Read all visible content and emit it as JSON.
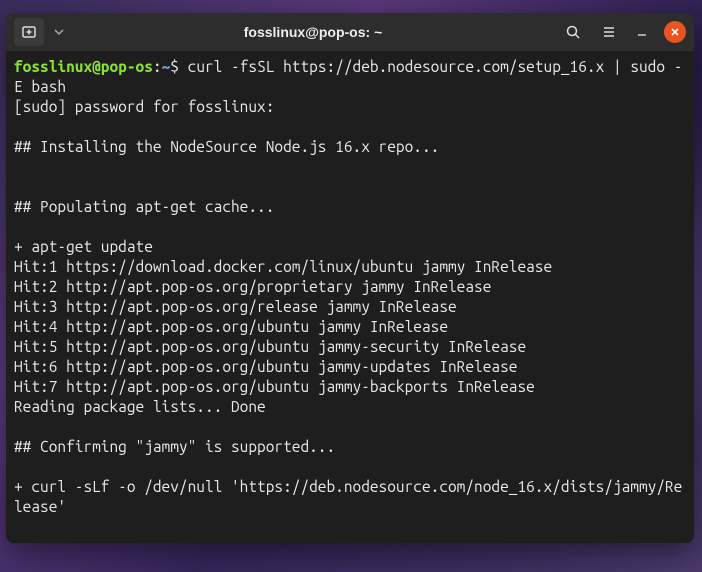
{
  "titlebar": {
    "title": "fosslinux@pop-os: ~"
  },
  "prompt": {
    "user_host": "fosslinux@pop-os",
    "separator": ":",
    "path": "~",
    "symbol": "$"
  },
  "command": "curl -fsSL https://deb.nodesource.com/setup_16.x | sudo -E bash",
  "output_lines": [
    "[sudo] password for fosslinux:",
    "",
    "## Installing the NodeSource Node.js 16.x repo...",
    "",
    "",
    "## Populating apt-get cache...",
    "",
    "+ apt-get update",
    "Hit:1 https://download.docker.com/linux/ubuntu jammy InRelease",
    "Hit:2 http://apt.pop-os.org/proprietary jammy InRelease",
    "Hit:3 http://apt.pop-os.org/release jammy InRelease",
    "Hit:4 http://apt.pop-os.org/ubuntu jammy InRelease",
    "Hit:5 http://apt.pop-os.org/ubuntu jammy-security InRelease",
    "Hit:6 http://apt.pop-os.org/ubuntu jammy-updates InRelease",
    "Hit:7 http://apt.pop-os.org/ubuntu jammy-backports InRelease",
    "Reading package lists... Done",
    "",
    "## Confirming \"jammy\" is supported...",
    "",
    "+ curl -sLf -o /dev/null 'https://deb.nodesource.com/node_16.x/dists/jammy/Release'",
    ""
  ]
}
